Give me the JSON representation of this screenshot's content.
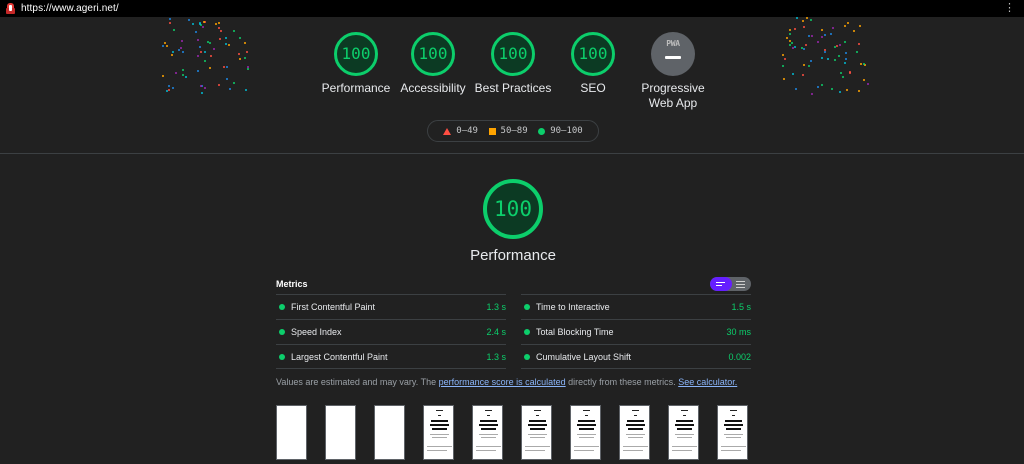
{
  "browser": {
    "url": "https://www.ageri.net/",
    "menu_icon": "kebab-menu-icon"
  },
  "categories": [
    {
      "score": "100",
      "label": "Performance"
    },
    {
      "score": "100",
      "label": "Accessibility"
    },
    {
      "score": "100",
      "label": "Best Practices"
    },
    {
      "score": "100",
      "label": "SEO"
    }
  ],
  "pwa": {
    "logo_text": "PWA",
    "label_line1": "Progressive",
    "label_line2": "Web App",
    "icon": "pwa-icon"
  },
  "legend": {
    "fail": "0–49",
    "average": "50–89",
    "pass": "90–100"
  },
  "performance": {
    "score": "100",
    "title": "Performance"
  },
  "metrics": {
    "heading": "Metrics",
    "left": [
      {
        "name": "First Contentful Paint",
        "value": "1.3 s"
      },
      {
        "name": "Speed Index",
        "value": "2.4 s"
      },
      {
        "name": "Largest Contentful Paint",
        "value": "1.3 s"
      }
    ],
    "right": [
      {
        "name": "Time to Interactive",
        "value": "1.5 s"
      },
      {
        "name": "Total Blocking Time",
        "value": "30 ms"
      },
      {
        "name": "Cumulative Layout Shift",
        "value": "0.002"
      }
    ]
  },
  "note": {
    "prefix": "Values are estimated and may vary. The ",
    "link1": "performance score is calculated",
    "middle": " directly from these metrics. ",
    "link2": "See calculator."
  },
  "colors": {
    "pass": "#0cce6b",
    "average": "#ffa400",
    "fail": "#ff4e42",
    "toggle_active": "#651fff",
    "background": "#212121"
  },
  "filmstrip": {
    "frame_count": 10,
    "blank_frames": 3
  }
}
